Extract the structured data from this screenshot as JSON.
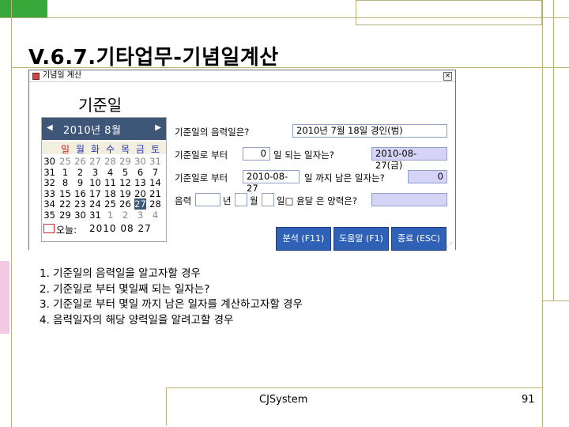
{
  "slide": {
    "title": "V.6.7.기타업무-기념일계산",
    "steps": [
      "1. 기준일의 음력일을 알고자할 경우",
      "2. 기준일로 부터 몇일째 되는 일자는?",
      "3. 기준일로 부터 몇일 까지 남은 일자를 계산하고자할 경우",
      "4. 음력일자의 해당 양력일을 알려고할 경우"
    ],
    "footer_company": "CJSystem",
    "footer_page": "91"
  },
  "window": {
    "title": "기념일 계산",
    "close": "×",
    "base_date_label": "기준일"
  },
  "calendar": {
    "prev": "◀",
    "next": "▶",
    "month": "2010년 8월",
    "weekdays": [
      "일",
      "월",
      "화",
      "수",
      "목",
      "금",
      "토"
    ],
    "weeks": [
      {
        "wk": "30",
        "days": [
          "25",
          "26",
          "27",
          "28",
          "29",
          "30",
          "31"
        ]
      },
      {
        "wk": "31",
        "days": [
          "1",
          "2",
          "3",
          "4",
          "5",
          "6",
          "7"
        ]
      },
      {
        "wk": "32",
        "days": [
          "8",
          "9",
          "10",
          "11",
          "12",
          "13",
          "14"
        ]
      },
      {
        "wk": "33",
        "days": [
          "15",
          "16",
          "17",
          "18",
          "19",
          "20",
          "21"
        ]
      },
      {
        "wk": "34",
        "days": [
          "22",
          "23",
          "24",
          "25",
          "26",
          "27",
          "28"
        ]
      },
      {
        "wk": "35",
        "days": [
          "29",
          "30",
          "31",
          "1",
          "2",
          "3",
          "4"
        ]
      }
    ],
    "selected_day": "27",
    "today_label": "오늘:",
    "today_value": "2010 08 27"
  },
  "form": {
    "lunar_label": "기준일의 음력일은?",
    "lunar_value": "2010년 7월 18일  경인(범)",
    "from_label": "기준일로 부터",
    "from_days": "0",
    "from_suffix": "일 되는 일자는?",
    "from_result": "2010-08-27(금)",
    "until_label": "기준일로 부터",
    "until_date": "2010-08-27",
    "until_suffix": "일 까지 남은 일자는?",
    "until_result": "0",
    "lunar_input_label": "음력",
    "year_unit": "년",
    "month_unit": "월",
    "day_unit_suffix": "일□ 윤달 은 양력은?",
    "lunar_year": "",
    "lunar_month": "",
    "lunar_day": "",
    "solar_result": ""
  },
  "buttons": {
    "analyze": "분석 (F11)",
    "help": "도움말 (F1)",
    "close": "종료 (ESC)"
  },
  "colors": {
    "calendar_header": "#3e5778",
    "button_blue": "#2f62b6",
    "field_highlight": "#d6d4f6",
    "deco_pink": "#f2c8e2",
    "deco_line": "#b9b07a"
  }
}
